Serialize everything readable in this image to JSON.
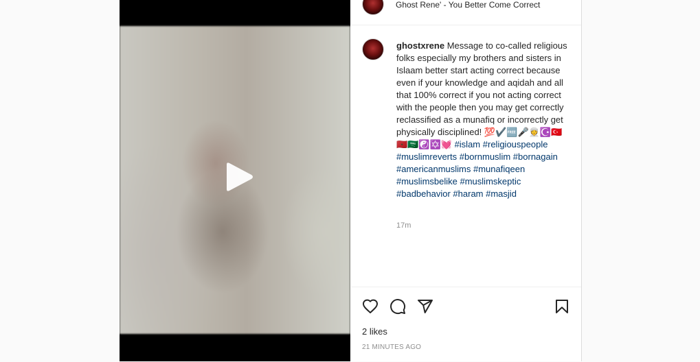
{
  "post": {
    "music_track": "Ghost Rene' - You Better Come Correct",
    "username": "ghostxrene",
    "caption_text": "Message to co-called religious folks especially my brothers and sisters in Islaam better start acting correct because even if your knowledge and aqidah and all that 100% correct if you not acting correct with the people then you may get correctly reclassified as a munafiq or incorrectly get physically disciplined!",
    "caption_emojis": "💯✔️🆓🎤👳☪️🇹🇷🇲🇦🇸🇦☯️✡️💓",
    "hashtags": [
      "#islam",
      "#religiouspeople",
      "#muslimreverts",
      "#bornmuslim",
      "#bornagain",
      "#americanmuslims",
      "#munafiqeen",
      "#muslimsbelike",
      "#muslimskeptic",
      "#badbehavior",
      "#haram",
      "#masjid"
    ],
    "comment_age": "17m",
    "likes_text": "2 likes",
    "timestamp": "21 MINUTES AGO"
  },
  "icons": {
    "play": "play-icon",
    "like": "heart-icon",
    "comment": "comment-icon",
    "share": "send-icon",
    "save": "bookmark-icon"
  },
  "colors": {
    "hashtag": "#00376b",
    "secondary_text": "#8e8e8e",
    "border": "#dbdbdb"
  }
}
